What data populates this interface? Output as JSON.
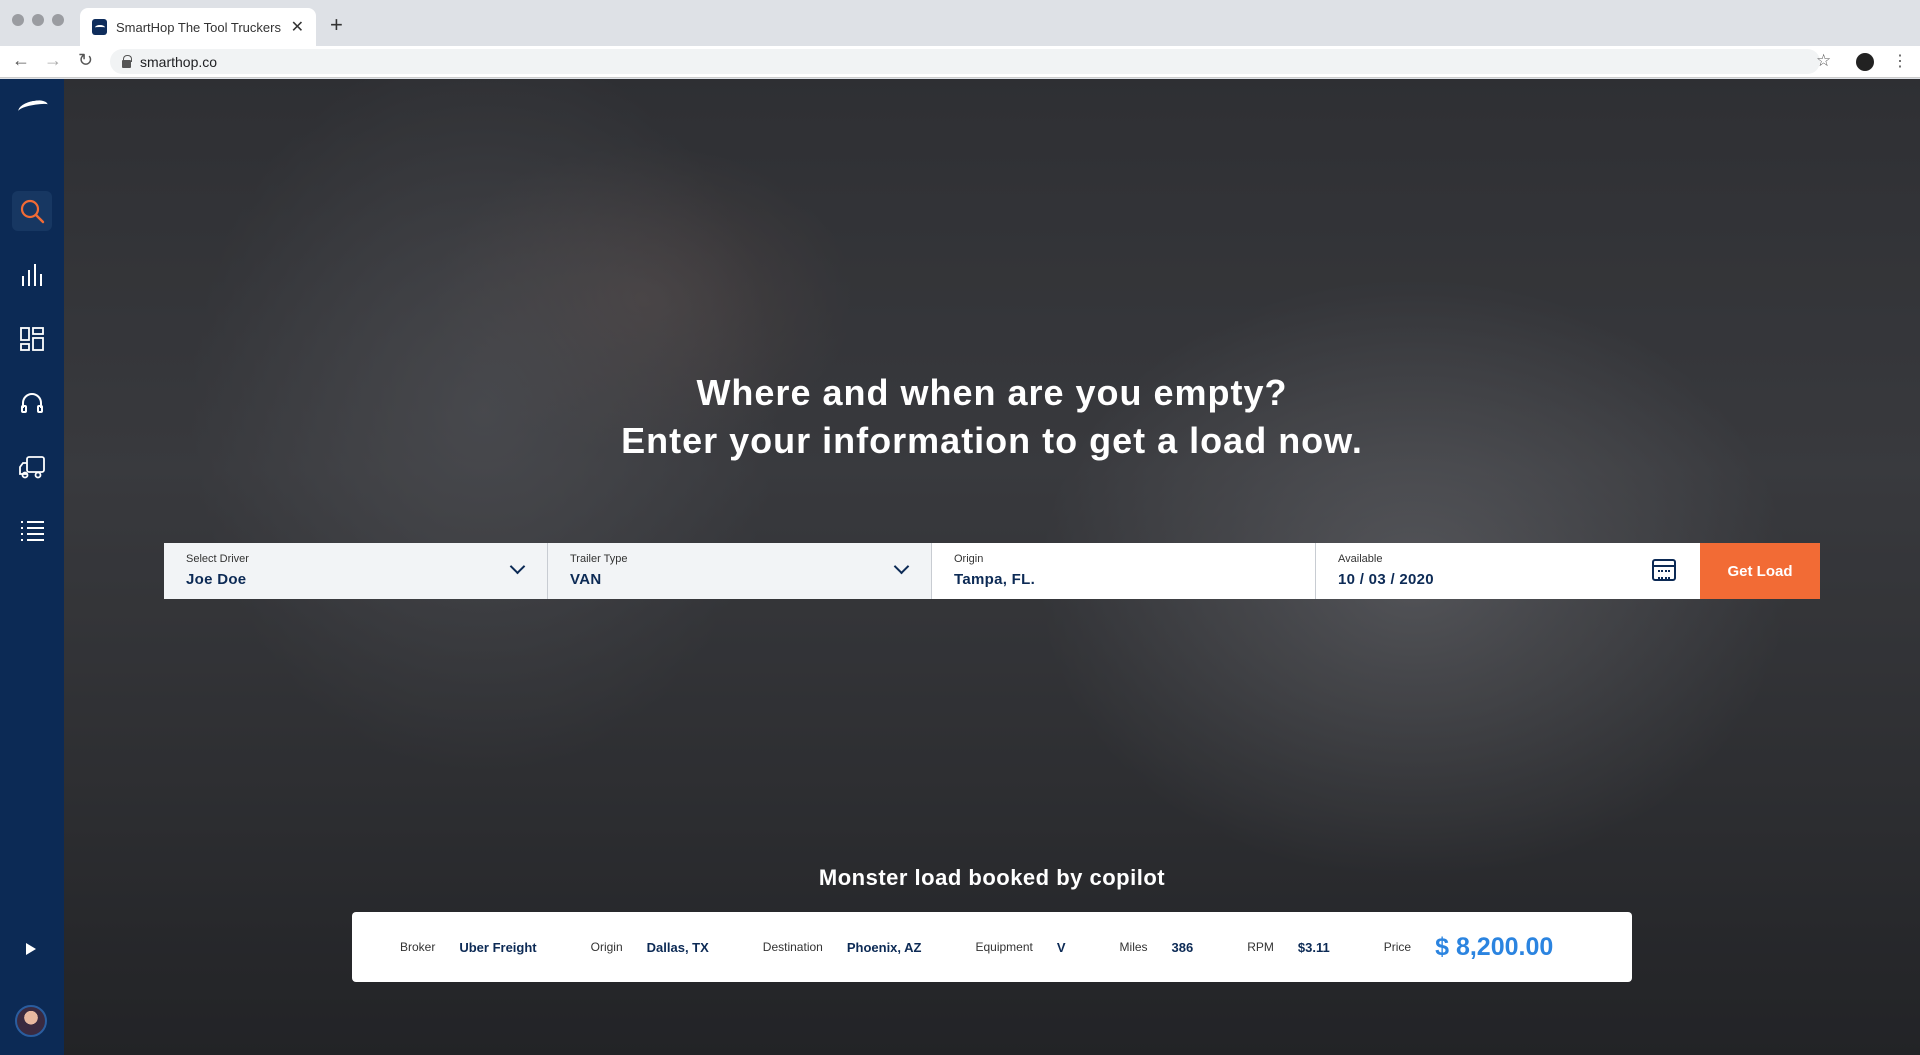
{
  "browser": {
    "tab_title": "SmartHop The Tool Truckers U",
    "url": "smarthop.co",
    "icons": {
      "back": "arrow-left-icon",
      "forward": "arrow-right-icon",
      "reload": "reload-icon",
      "star": "star-icon",
      "menu": "kebab-menu-icon"
    }
  },
  "sidebar": {
    "items": [
      {
        "name": "search",
        "icon": "search-icon",
        "active": true
      },
      {
        "name": "analytics",
        "icon": "bar-chart-icon"
      },
      {
        "name": "dashboard",
        "icon": "dashboard-icon"
      },
      {
        "name": "support",
        "icon": "headset-icon"
      },
      {
        "name": "trucks",
        "icon": "truck-icon"
      },
      {
        "name": "list",
        "icon": "list-icon"
      }
    ]
  },
  "hero": {
    "line1": "Where and when are you empty?",
    "line2_prefix": "Enter your information to ",
    "line2_bold": "get a load now."
  },
  "search": {
    "driver_label": "Select Driver",
    "driver_value": "Joe Doe",
    "trailer_label": "Trailer Type",
    "trailer_value": "VAN",
    "origin_label": "Origin",
    "origin_value": "Tampa, FL.",
    "available_label": "Available",
    "available_value": "10 / 03 / 2020",
    "submit_label": "Get Load"
  },
  "booked": {
    "title": "Monster load booked by copilot",
    "broker_label": "Broker",
    "broker_value": "Uber Freight",
    "origin_label": "Origin",
    "origin_value": "Dallas, TX",
    "destination_label": "Destination",
    "destination_value": "Phoenix, AZ",
    "equipment_label": "Equipment",
    "equipment_value": "V",
    "miles_label": "Miles",
    "miles_value": "386",
    "rpm_label": "RPM",
    "rpm_value": "$3.11",
    "price_label": "Price",
    "price_value": "$ 8,200.00"
  },
  "colors": {
    "sidebar": "#0c2a55",
    "accent": "#f26b35",
    "price": "#2b84e0"
  }
}
